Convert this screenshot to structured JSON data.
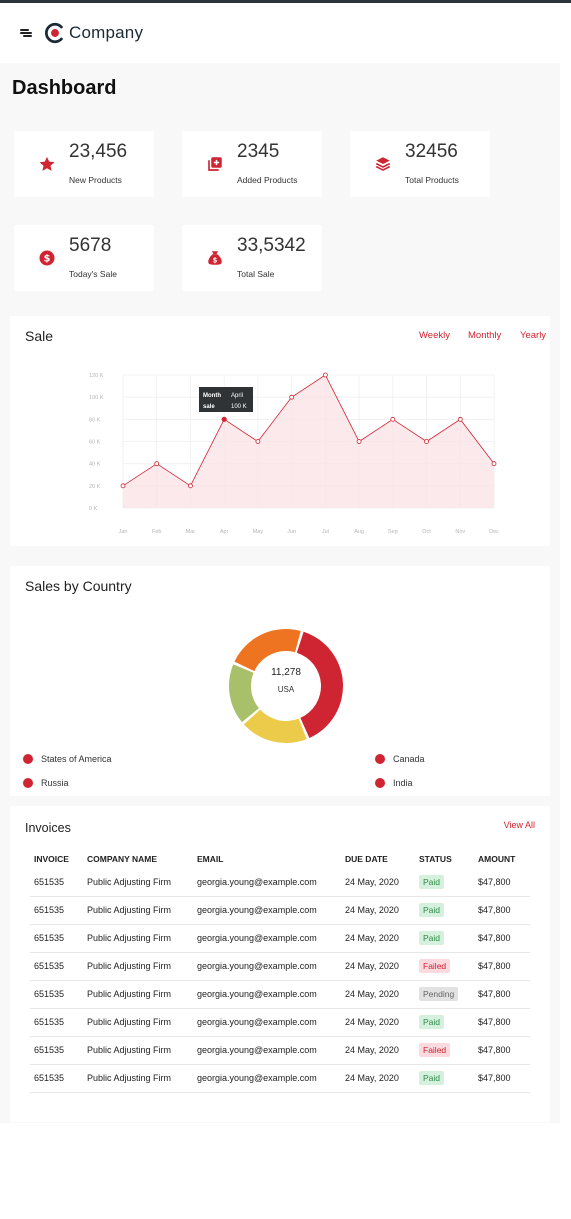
{
  "header": {
    "brand": "Company"
  },
  "page": {
    "title": "Dashboard"
  },
  "stats": [
    {
      "value": "23,456",
      "label": "New Products",
      "icon": "star-icon"
    },
    {
      "value": "2345",
      "label": "Added Products",
      "icon": "add-box-icon"
    },
    {
      "value": "32456",
      "label": "Total Products",
      "icon": "layers-icon"
    },
    {
      "value": "5678",
      "label": "Today's Sale",
      "icon": "dollar-coin-icon"
    },
    {
      "value": "33,5342",
      "label": "Total Sale",
      "icon": "money-bag-icon"
    }
  ],
  "sale": {
    "title": "Sale",
    "tabs": [
      "Weekly",
      "Monthly",
      "Yearly"
    ],
    "tooltip": {
      "k1": "Month",
      "v1": "April",
      "k2": "sale",
      "v2": "100 K"
    }
  },
  "chart_data": {
    "type": "area",
    "categories": [
      "Jan",
      "Feb",
      "Mar",
      "Apr",
      "May",
      "Jun",
      "Jul",
      "Aug",
      "Sep",
      "Oct",
      "Nov",
      "Dec"
    ],
    "values": [
      20,
      40,
      20,
      80,
      60,
      100,
      120,
      60,
      80,
      60,
      80,
      40
    ],
    "ylim": [
      0,
      120
    ],
    "yticks": [
      "0 K",
      "20 K",
      "40 K",
      "60 K",
      "80 K",
      "100 K",
      "120 K"
    ],
    "grid": true,
    "color": "#cf2431"
  },
  "country": {
    "title": "Sales by Country",
    "center_value": "11,278",
    "center_label": "USA",
    "legend": [
      "States of America",
      "Canada",
      "Russia",
      "India"
    ],
    "donut": {
      "type": "pie",
      "segments": [
        {
          "value": 38,
          "color": "#cf2431"
        },
        {
          "value": 19,
          "color": "#eccb4a"
        },
        {
          "value": 17,
          "color": "#a9c06a"
        },
        {
          "value": 22,
          "color": "#ef7421"
        }
      ]
    }
  },
  "invoices": {
    "title": "Invoices",
    "view_all": "View All",
    "columns": [
      "INVOICE",
      "COMPANY NAME",
      "EMAIL",
      "DUE DATE",
      "STATUS",
      "AMOUNT"
    ],
    "rows": [
      {
        "invoice": "651535",
        "company": "Public Adjusting Firm",
        "email": "georgia.young@example.com",
        "due": "24 May, 2020",
        "status": "Paid",
        "amount": "$47,800"
      },
      {
        "invoice": "651535",
        "company": "Public Adjusting Firm",
        "email": "georgia.young@example.com",
        "due": "24 May, 2020",
        "status": "Paid",
        "amount": "$47,800"
      },
      {
        "invoice": "651535",
        "company": "Public Adjusting Firm",
        "email": "georgia.young@example.com",
        "due": "24 May, 2020",
        "status": "Paid",
        "amount": "$47,800"
      },
      {
        "invoice": "651535",
        "company": "Public Adjusting Firm",
        "email": "georgia.young@example.com",
        "due": "24 May, 2020",
        "status": "Failed",
        "amount": "$47,800"
      },
      {
        "invoice": "651535",
        "company": "Public Adjusting Firm",
        "email": "georgia.young@example.com",
        "due": "24 May, 2020",
        "status": "Pending",
        "amount": "$47,800"
      },
      {
        "invoice": "651535",
        "company": "Public Adjusting Firm",
        "email": "georgia.young@example.com",
        "due": "24 May, 2020",
        "status": "Paid",
        "amount": "$47,800"
      },
      {
        "invoice": "651535",
        "company": "Public Adjusting Firm",
        "email": "georgia.young@example.com",
        "due": "24 May, 2020",
        "status": "Failed",
        "amount": "$47,800"
      },
      {
        "invoice": "651535",
        "company": "Public Adjusting Firm",
        "email": "georgia.young@example.com",
        "due": "24 May, 2020",
        "status": "Paid",
        "amount": "$47,800"
      }
    ]
  },
  "colors": {
    "accent": "#cf2431",
    "paid": "#2e8b4a",
    "failed": "#cf2431",
    "pending": "#666666"
  }
}
